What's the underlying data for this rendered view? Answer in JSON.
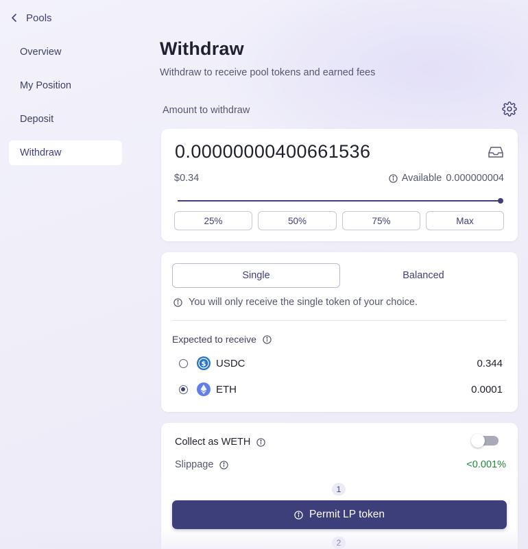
{
  "nav": {
    "back_label": "Pools",
    "items": [
      {
        "label": "Overview",
        "active": false
      },
      {
        "label": "My Position",
        "active": false
      },
      {
        "label": "Deposit",
        "active": false
      },
      {
        "label": "Withdraw",
        "active": true
      }
    ]
  },
  "page": {
    "title": "Withdraw",
    "subtitle": "Withdraw to receive pool tokens and earned fees"
  },
  "amount": {
    "label": "Amount to withdraw",
    "value": "0.00000000400661536",
    "usd_value": "$0.34",
    "available_label": "Available",
    "available_value": "0.000000004",
    "slider_fraction": 1.0,
    "presets": [
      "25%",
      "50%",
      "75%",
      "Max"
    ]
  },
  "mode": {
    "tabs": [
      {
        "label": "Single",
        "active": true
      },
      {
        "label": "Balanced",
        "active": false
      }
    ],
    "info": "You will only receive the single token of your choice.",
    "expected_label": "Expected to receive",
    "tokens": [
      {
        "symbol": "USDC",
        "amount": "0.344",
        "selected": false,
        "icon": "usdc-icon",
        "color": "#2775ca"
      },
      {
        "symbol": "ETH",
        "amount": "0.0001",
        "selected": true,
        "icon": "eth-icon",
        "color": "#627eea"
      }
    ]
  },
  "collect": {
    "label": "Collect as WETH",
    "toggle_on": false,
    "slippage_label": "Slippage",
    "slippage_value": "<0.001%",
    "slippage_color": "#1e8a3a",
    "steps": [
      "1",
      "2"
    ],
    "permit_label": "Permit LP token"
  },
  "colors": {
    "accent": "#3d3f7a",
    "background": "#efeef9"
  }
}
